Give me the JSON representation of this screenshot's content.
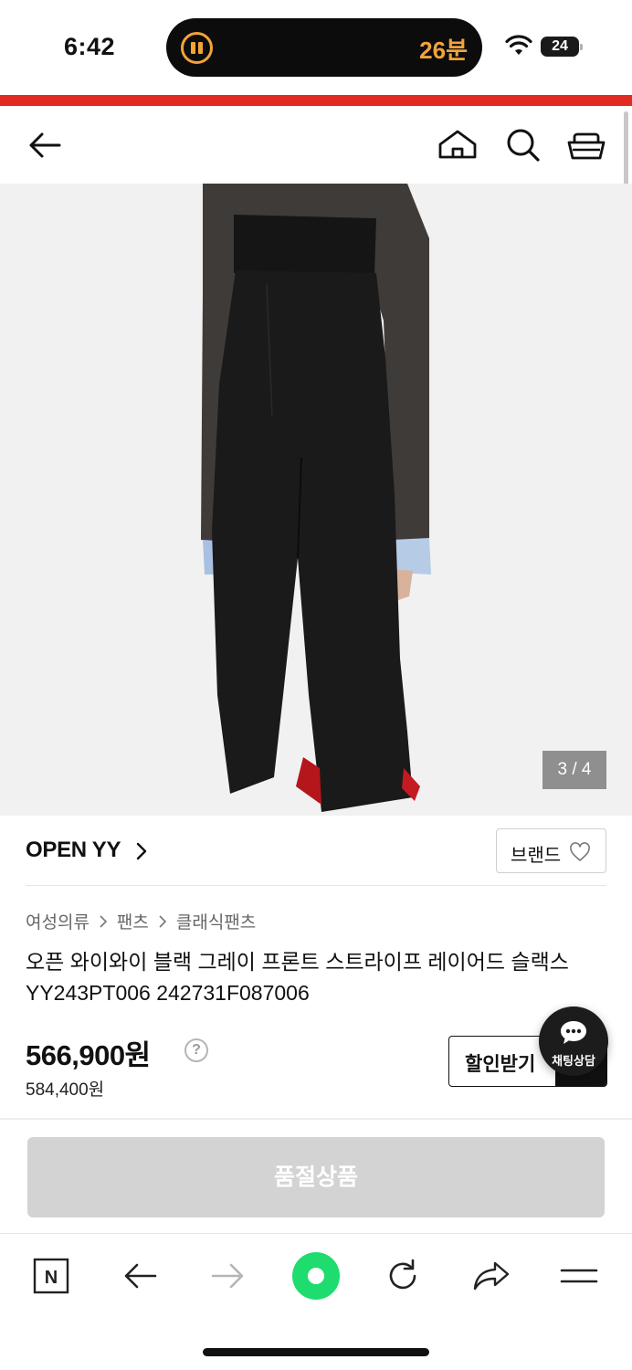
{
  "status_bar": {
    "time": "6:42",
    "live_activity_timer": "26분",
    "battery_level": "24"
  },
  "header": {
    "back_icon": "arrow-left-icon",
    "home_icon": "home-icon",
    "search_icon": "search-icon",
    "cart_icon": "basket-icon"
  },
  "gallery": {
    "counter": "3 / 4"
  },
  "brand": {
    "name": "OPEN YY",
    "button_label": "브랜드"
  },
  "breadcrumb": [
    "여성의류",
    "팬츠",
    "클래식팬츠"
  ],
  "product": {
    "title_line1": "오픈 와이와이 블랙 그레이 프론트 스트라이프 레이어드 슬랙스",
    "title_line2": "YY243PT006 242731F087006",
    "price": "566,900원",
    "help_mark": "?",
    "original_price": "584,400원",
    "discount_button": "할인받기"
  },
  "chat": {
    "label": "채팅상담"
  },
  "purchase": {
    "soldout_label": "품절상품"
  },
  "browser_bar": {
    "naver_icon": "N",
    "items": [
      "naver-icon",
      "back-icon",
      "forward-icon",
      "green-dot-icon",
      "reload-icon",
      "share-icon",
      "menu-icon"
    ]
  },
  "colors": {
    "accent_red": "#e22a24",
    "timer_orange": "#f2a33a",
    "naver_green": "#1fdc6e",
    "soldout_gray": "#d3d3d3"
  }
}
